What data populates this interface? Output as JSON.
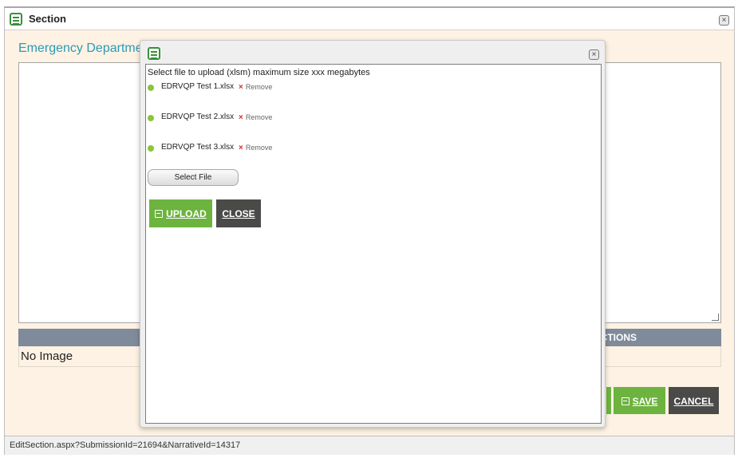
{
  "outer_window": {
    "title": "Section",
    "heading": "Emergency Departme",
    "image_bar_label": "CTIONS",
    "no_image": "No Image",
    "save_label": "SAVE",
    "cancel_label": "CANCEL",
    "status_url": "EditSection.aspx?SubmissionId=21694&NarrativeId=14317"
  },
  "modal": {
    "instruction": "Select file to upload (xlsm) maximum size xxx megabytes",
    "files": [
      {
        "name": "EDRVQP Test 1.xlsx",
        "remove_label": "Remove"
      },
      {
        "name": "EDRVQP Test 2.xlsx",
        "remove_label": "Remove"
      },
      {
        "name": "EDRVQP Test 3.xlsx",
        "remove_label": "Remove"
      }
    ],
    "select_file_label": "Select File",
    "upload_label": "UPLOAD",
    "close_label": "CLOSE"
  },
  "icons": {
    "window_icon": "document-lines-icon",
    "close_icon": "close-x-icon",
    "file_status_icon": "green-dot-icon",
    "remove_icon": "red-x-icon",
    "save_icon": "floppy-disk-icon"
  },
  "colors": {
    "accent_green": "#6db33f",
    "dark_button": "#4a4a48",
    "heading_teal": "#2b9ab8",
    "bar_slate": "#7f8a9a",
    "window_background": "#fdf2e3",
    "remove_red": "#d9302c"
  }
}
